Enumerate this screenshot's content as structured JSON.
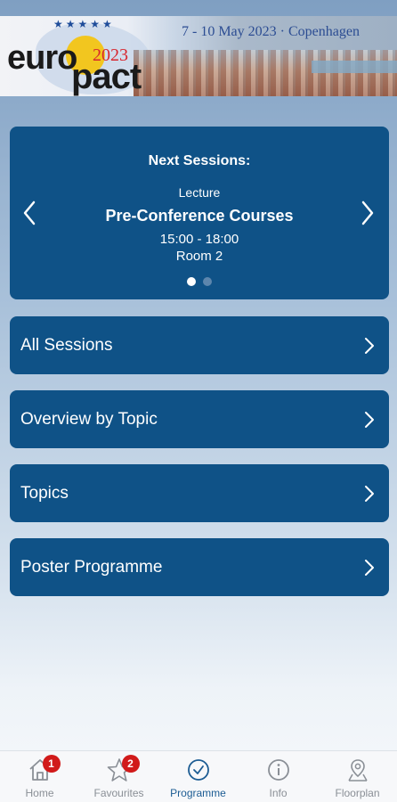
{
  "banner": {
    "logo_euro": "euro",
    "logo_pact": "pact",
    "logo_year": "2023",
    "date_location": "7 - 10 May 2023 · Copenhagen"
  },
  "next_sessions": {
    "heading": "Next Sessions:",
    "type": "Lecture",
    "title": "Pre-Conference Courses",
    "time": "15:00 - 18:00",
    "room": "Room 2",
    "pages": 2,
    "active_page": 1
  },
  "menu": [
    {
      "label": "All Sessions"
    },
    {
      "label": "Overview by Topic"
    },
    {
      "label": "Topics"
    },
    {
      "label": "Poster Programme"
    }
  ],
  "tabbar": [
    {
      "label": "Home",
      "icon": "home-icon",
      "badge": "1"
    },
    {
      "label": "Favourites",
      "icon": "star-icon",
      "badge": "2"
    },
    {
      "label": "Programme",
      "icon": "clock-icon",
      "active": true
    },
    {
      "label": "Info",
      "icon": "info-icon"
    },
    {
      "label": "Floorplan",
      "icon": "map-pin-icon"
    }
  ],
  "colors": {
    "card": "#0f5287",
    "accent": "#1c5c93",
    "badge": "#d11a1a"
  }
}
